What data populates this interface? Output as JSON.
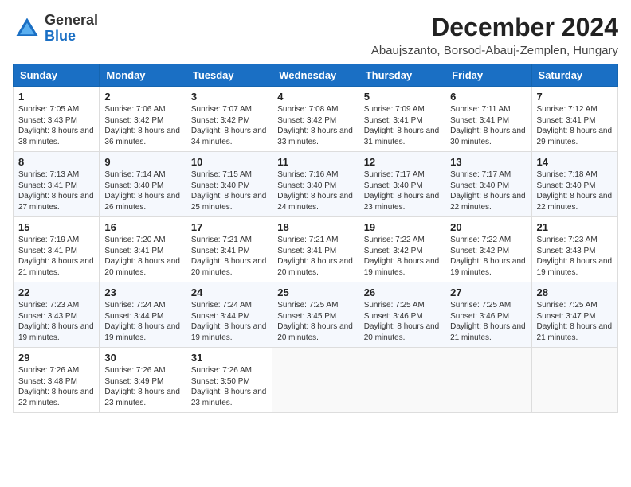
{
  "header": {
    "logo_general": "General",
    "logo_blue": "Blue",
    "month_title": "December 2024",
    "location": "Abaujszanto, Borsod-Abauj-Zemplen, Hungary"
  },
  "columns": [
    "Sunday",
    "Monday",
    "Tuesday",
    "Wednesday",
    "Thursday",
    "Friday",
    "Saturday"
  ],
  "weeks": [
    [
      {
        "day": "1",
        "sunrise": "Sunrise: 7:05 AM",
        "sunset": "Sunset: 3:43 PM",
        "daylight": "Daylight: 8 hours and 38 minutes."
      },
      {
        "day": "2",
        "sunrise": "Sunrise: 7:06 AM",
        "sunset": "Sunset: 3:42 PM",
        "daylight": "Daylight: 8 hours and 36 minutes."
      },
      {
        "day": "3",
        "sunrise": "Sunrise: 7:07 AM",
        "sunset": "Sunset: 3:42 PM",
        "daylight": "Daylight: 8 hours and 34 minutes."
      },
      {
        "day": "4",
        "sunrise": "Sunrise: 7:08 AM",
        "sunset": "Sunset: 3:42 PM",
        "daylight": "Daylight: 8 hours and 33 minutes."
      },
      {
        "day": "5",
        "sunrise": "Sunrise: 7:09 AM",
        "sunset": "Sunset: 3:41 PM",
        "daylight": "Daylight: 8 hours and 31 minutes."
      },
      {
        "day": "6",
        "sunrise": "Sunrise: 7:11 AM",
        "sunset": "Sunset: 3:41 PM",
        "daylight": "Daylight: 8 hours and 30 minutes."
      },
      {
        "day": "7",
        "sunrise": "Sunrise: 7:12 AM",
        "sunset": "Sunset: 3:41 PM",
        "daylight": "Daylight: 8 hours and 29 minutes."
      }
    ],
    [
      {
        "day": "8",
        "sunrise": "Sunrise: 7:13 AM",
        "sunset": "Sunset: 3:41 PM",
        "daylight": "Daylight: 8 hours and 27 minutes."
      },
      {
        "day": "9",
        "sunrise": "Sunrise: 7:14 AM",
        "sunset": "Sunset: 3:40 PM",
        "daylight": "Daylight: 8 hours and 26 minutes."
      },
      {
        "day": "10",
        "sunrise": "Sunrise: 7:15 AM",
        "sunset": "Sunset: 3:40 PM",
        "daylight": "Daylight: 8 hours and 25 minutes."
      },
      {
        "day": "11",
        "sunrise": "Sunrise: 7:16 AM",
        "sunset": "Sunset: 3:40 PM",
        "daylight": "Daylight: 8 hours and 24 minutes."
      },
      {
        "day": "12",
        "sunrise": "Sunrise: 7:17 AM",
        "sunset": "Sunset: 3:40 PM",
        "daylight": "Daylight: 8 hours and 23 minutes."
      },
      {
        "day": "13",
        "sunrise": "Sunrise: 7:17 AM",
        "sunset": "Sunset: 3:40 PM",
        "daylight": "Daylight: 8 hours and 22 minutes."
      },
      {
        "day": "14",
        "sunrise": "Sunrise: 7:18 AM",
        "sunset": "Sunset: 3:40 PM",
        "daylight": "Daylight: 8 hours and 22 minutes."
      }
    ],
    [
      {
        "day": "15",
        "sunrise": "Sunrise: 7:19 AM",
        "sunset": "Sunset: 3:41 PM",
        "daylight": "Daylight: 8 hours and 21 minutes."
      },
      {
        "day": "16",
        "sunrise": "Sunrise: 7:20 AM",
        "sunset": "Sunset: 3:41 PM",
        "daylight": "Daylight: 8 hours and 20 minutes."
      },
      {
        "day": "17",
        "sunrise": "Sunrise: 7:21 AM",
        "sunset": "Sunset: 3:41 PM",
        "daylight": "Daylight: 8 hours and 20 minutes."
      },
      {
        "day": "18",
        "sunrise": "Sunrise: 7:21 AM",
        "sunset": "Sunset: 3:41 PM",
        "daylight": "Daylight: 8 hours and 20 minutes."
      },
      {
        "day": "19",
        "sunrise": "Sunrise: 7:22 AM",
        "sunset": "Sunset: 3:42 PM",
        "daylight": "Daylight: 8 hours and 19 minutes."
      },
      {
        "day": "20",
        "sunrise": "Sunrise: 7:22 AM",
        "sunset": "Sunset: 3:42 PM",
        "daylight": "Daylight: 8 hours and 19 minutes."
      },
      {
        "day": "21",
        "sunrise": "Sunrise: 7:23 AM",
        "sunset": "Sunset: 3:43 PM",
        "daylight": "Daylight: 8 hours and 19 minutes."
      }
    ],
    [
      {
        "day": "22",
        "sunrise": "Sunrise: 7:23 AM",
        "sunset": "Sunset: 3:43 PM",
        "daylight": "Daylight: 8 hours and 19 minutes."
      },
      {
        "day": "23",
        "sunrise": "Sunrise: 7:24 AM",
        "sunset": "Sunset: 3:44 PM",
        "daylight": "Daylight: 8 hours and 19 minutes."
      },
      {
        "day": "24",
        "sunrise": "Sunrise: 7:24 AM",
        "sunset": "Sunset: 3:44 PM",
        "daylight": "Daylight: 8 hours and 19 minutes."
      },
      {
        "day": "25",
        "sunrise": "Sunrise: 7:25 AM",
        "sunset": "Sunset: 3:45 PM",
        "daylight": "Daylight: 8 hours and 20 minutes."
      },
      {
        "day": "26",
        "sunrise": "Sunrise: 7:25 AM",
        "sunset": "Sunset: 3:46 PM",
        "daylight": "Daylight: 8 hours and 20 minutes."
      },
      {
        "day": "27",
        "sunrise": "Sunrise: 7:25 AM",
        "sunset": "Sunset: 3:46 PM",
        "daylight": "Daylight: 8 hours and 21 minutes."
      },
      {
        "day": "28",
        "sunrise": "Sunrise: 7:25 AM",
        "sunset": "Sunset: 3:47 PM",
        "daylight": "Daylight: 8 hours and 21 minutes."
      }
    ],
    [
      {
        "day": "29",
        "sunrise": "Sunrise: 7:26 AM",
        "sunset": "Sunset: 3:48 PM",
        "daylight": "Daylight: 8 hours and 22 minutes."
      },
      {
        "day": "30",
        "sunrise": "Sunrise: 7:26 AM",
        "sunset": "Sunset: 3:49 PM",
        "daylight": "Daylight: 8 hours and 23 minutes."
      },
      {
        "day": "31",
        "sunrise": "Sunrise: 7:26 AM",
        "sunset": "Sunset: 3:50 PM",
        "daylight": "Daylight: 8 hours and 23 minutes."
      },
      null,
      null,
      null,
      null
    ]
  ]
}
